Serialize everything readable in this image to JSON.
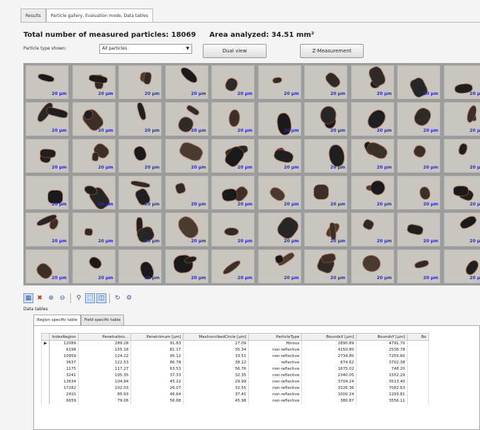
{
  "tabs": {
    "results": "Results",
    "gallery": "Particle gallery, Evaluation mode, Data tables"
  },
  "summary": {
    "total_label": "Total number of measured particles: 18069",
    "area_label": "Area analyzed: 34.51 mm²"
  },
  "filter": {
    "label": "Particle type shown:",
    "value": "All particles"
  },
  "buttons": {
    "dual_view": "Dual view",
    "z_measurement": "Z-Measurement"
  },
  "gallery": {
    "scale_label": "20 µm"
  },
  "data_tables": {
    "label": "Data tables",
    "subtabs": [
      "Region specific table",
      "Field specific table"
    ],
    "columns": [
      "IndexRegion",
      "Penetration...",
      "Penetrimum [µm]",
      "MaxInscribedCircle [µm]",
      "ParticleType",
      "BoundsX [µm]",
      "BoundsY [µm]",
      "Bo"
    ],
    "rows": [
      [
        "12089",
        "289.28",
        "91.83",
        "27.09",
        "fibrous",
        "2890.89",
        "4791.70"
      ],
      [
        "6198",
        "155.18",
        "81.17",
        "35.34",
        "non-reflective",
        "4150.80",
        "2536.78"
      ],
      [
        "10959",
        "124.22",
        "95.12",
        "33.51",
        "non-reflective",
        "2734.80",
        "7255.60"
      ],
      [
        "3637",
        "122.53",
        "86.78",
        "38.12",
        "reflective",
        "874.62",
        "3702.38"
      ],
      [
        "1175",
        "117.27",
        "63.53",
        "56.76",
        "non-reflective",
        "1675.02",
        "748.20"
      ],
      [
        "3241",
        "105.35",
        "37.33",
        "32.35",
        "non-reflective",
        "2340.05",
        "1552.29"
      ],
      [
        "13634",
        "104.94",
        "45.22",
        "29.99",
        "non-reflective",
        "3704.24",
        "3513.40"
      ],
      [
        "17282",
        "102.03",
        "26.07",
        "32.55",
        "non-reflective",
        "3326.36",
        "7082.63"
      ],
      [
        "2410",
        "85.93",
        "46.64",
        "37.41",
        "non-reflective",
        "1000.24",
        "1293.81"
      ],
      [
        "6659",
        "79.06",
        "56.68",
        "45.98",
        "non-reflective",
        "380.87",
        "3556.11"
      ]
    ]
  }
}
